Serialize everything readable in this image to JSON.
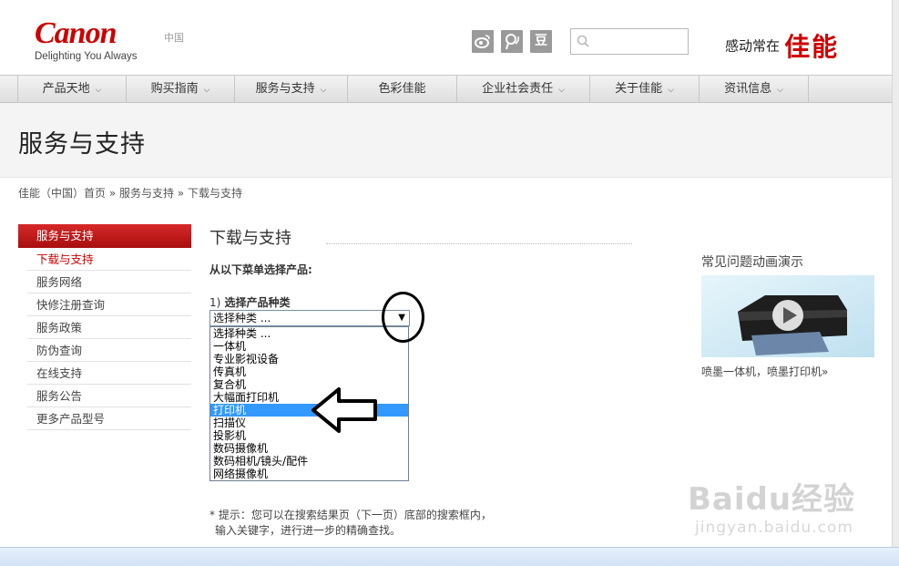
{
  "header": {
    "logo_word": "Canon",
    "logo_tagline": "Delighting You Always",
    "region": "中国",
    "social": [
      {
        "icon": "weibo-icon",
        "glyph": "☀"
      },
      {
        "icon": "tencent-weibo-icon",
        "glyph": "Ⓟ"
      },
      {
        "icon": "douban-icon",
        "glyph": "豆"
      }
    ],
    "search_placeholder": "",
    "slogan_small": "感动常在",
    "slogan_big": "佳能"
  },
  "nav": [
    {
      "label": "产品天地",
      "has_menu": true
    },
    {
      "label": "购买指南",
      "has_menu": true
    },
    {
      "label": "服务与支持",
      "has_menu": true
    },
    {
      "label": "色彩佳能",
      "has_menu": false
    },
    {
      "label": "企业社会责任",
      "has_menu": true
    },
    {
      "label": "关于佳能",
      "has_menu": true
    },
    {
      "label": "资讯信息",
      "has_menu": true
    }
  ],
  "page_title": "服务与支持",
  "breadcrumb": "佳能（中国）首页 » 服务与支持 » 下载与支持",
  "sidebar": {
    "heading": "服务与支持",
    "items": [
      {
        "label": "下载与支持",
        "active": true
      },
      {
        "label": "服务网络",
        "active": false
      },
      {
        "label": "快修注册查询",
        "active": false
      },
      {
        "label": "服务政策",
        "active": false
      },
      {
        "label": "防伪查询",
        "active": false
      },
      {
        "label": "在线支持",
        "active": false
      },
      {
        "label": "服务公告",
        "active": false
      },
      {
        "label": "更多产品型号",
        "active": false
      }
    ]
  },
  "main": {
    "heading": "下载与支持",
    "instruction": "从以下菜单选择产品:",
    "step_number": "1)",
    "step_label": "选择产品种类",
    "select_value": "选择种类 ...",
    "options": [
      {
        "label": "选择种类 ...",
        "selected": false
      },
      {
        "label": "一体机",
        "selected": false
      },
      {
        "label": "专业影视设备",
        "selected": false
      },
      {
        "label": "传真机",
        "selected": false
      },
      {
        "label": "复合机",
        "selected": false
      },
      {
        "label": "大幅面打印机",
        "selected": false
      },
      {
        "label": "打印机",
        "selected": true
      },
      {
        "label": "扫描仪",
        "selected": false
      },
      {
        "label": "投影机",
        "selected": false
      },
      {
        "label": "数码摄像机",
        "selected": false
      },
      {
        "label": "数码相机/镜头/配件",
        "selected": false
      },
      {
        "label": "网络摄像机",
        "selected": false
      }
    ],
    "hint_line1": "* 提示：您可以在搜索结果页（下一页）底部的搜索框内，",
    "hint_line2": "输入关键字，进行进一步的精确查找。"
  },
  "aside": {
    "title": "常见问题动画演示",
    "caption": "喷墨一体机，喷墨打印机»"
  },
  "watermark": {
    "text": "Baidu经验",
    "sub": "jingyan.baidu.com"
  }
}
